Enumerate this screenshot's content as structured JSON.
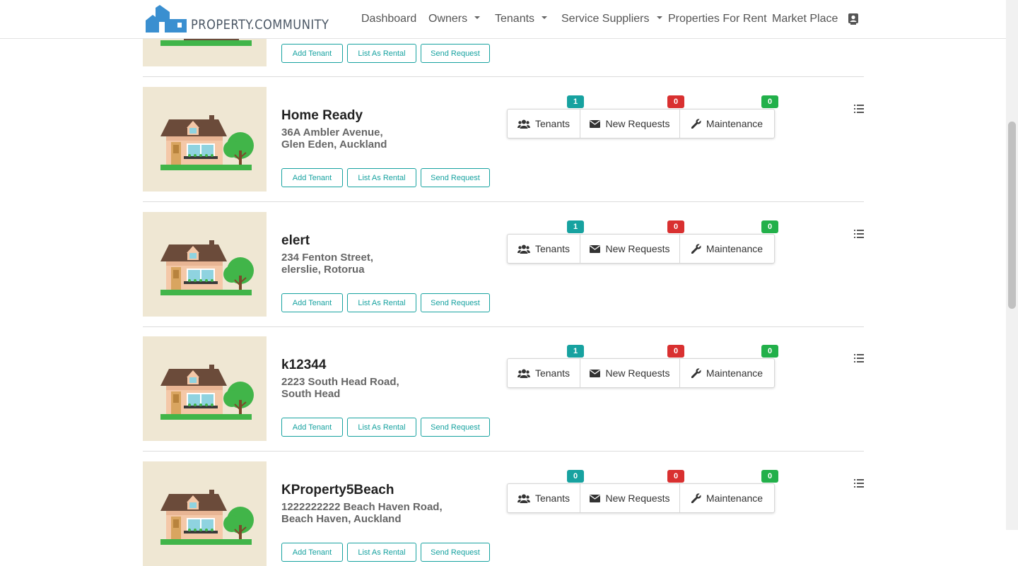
{
  "brand": {
    "name": "PROPERTY.COMMUNITY",
    "logo_color": "#3a8fd0"
  },
  "nav": {
    "items": [
      {
        "label": "Dashboard",
        "dropdown": false
      },
      {
        "label": "Owners",
        "dropdown": true
      },
      {
        "label": "Tenants",
        "dropdown": true
      },
      {
        "label": "Service Suppliers",
        "dropdown": true
      },
      {
        "label": "Properties For Rent",
        "dropdown": false
      },
      {
        "label": "Market Place",
        "dropdown": false
      }
    ],
    "contact_icon": "contact-card-icon"
  },
  "colors": {
    "accent": "#17a2a0",
    "tenants_badge": "#17a2a0",
    "requests_badge": "#d93030",
    "maintenance_badge": "#22b04a"
  },
  "actions": {
    "add_tenant": "Add Tenant",
    "list_as_rental": "List As Rental",
    "send_request": "Send Request"
  },
  "stats_labels": {
    "tenants": "Tenants",
    "new_requests": "New Requests",
    "maintenance": "Maintenance"
  },
  "properties": [
    {
      "title": "Home Ready",
      "address_line1": "36A Ambler Avenue,",
      "address_line2": "Glen Eden, Auckland",
      "tenants": "1",
      "new_requests": "0",
      "maintenance": "0"
    },
    {
      "title": "elert",
      "address_line1": "234 Fenton Street,",
      "address_line2": "elerslie, Rotorua",
      "tenants": "1",
      "new_requests": "0",
      "maintenance": "0"
    },
    {
      "title": "k12344",
      "address_line1": "2223 South Head Road,",
      "address_line2": "South Head",
      "tenants": "1",
      "new_requests": "0",
      "maintenance": "0"
    },
    {
      "title": "KProperty5Beach",
      "address_line1": "1222222222 Beach Haven Road,",
      "address_line2": "Beach Haven, Auckland",
      "tenants": "0",
      "new_requests": "0",
      "maintenance": "0"
    }
  ]
}
